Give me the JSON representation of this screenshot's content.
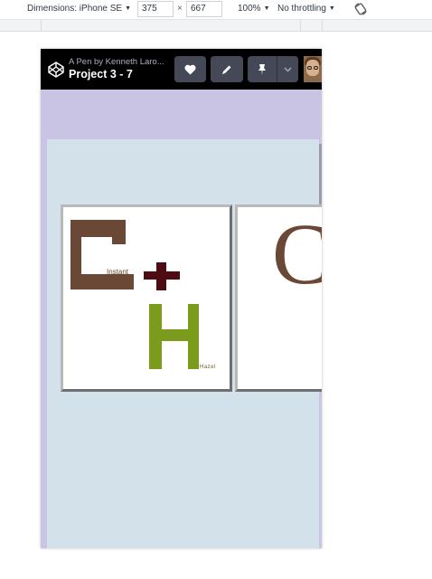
{
  "devtools": {
    "dimensions_label": "Dimensions: iPhone SE",
    "width_value": "375",
    "height_value": "667",
    "times_sign": "×",
    "zoom": "100%",
    "throttling": "No throttling",
    "icons": {
      "rotate": "rotate-icon"
    }
  },
  "codepen": {
    "pen_by": "A Pen by Kenneth Laro...",
    "title": "Project 3 - 7",
    "buttons": [
      "heart-icon",
      "pencil-icon",
      "pin-icon",
      "chevron-down-icon"
    ],
    "header_bg": "#000000",
    "button_bg": "#444857"
  },
  "artwork": {
    "background": "#cac4e4",
    "panel": "#d3e1ea",
    "tile_1": {
      "c_label": "Instant",
      "h_label": "Hazel",
      "c_color": "#6b4836",
      "plus_color": "#4e0b14",
      "h_color": "#7a9b1c"
    },
    "tile_2": {
      "letter": "C",
      "letter_color": "#6b4836"
    }
  }
}
